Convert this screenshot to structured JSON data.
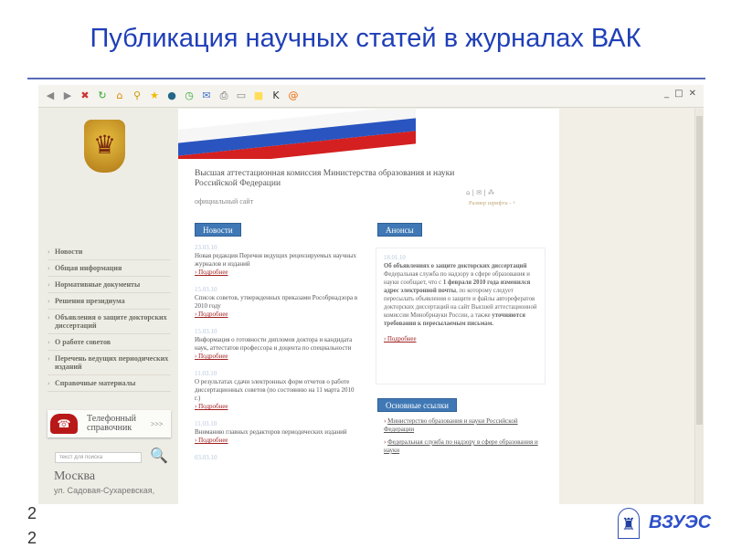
{
  "slide": {
    "title": "Публикация научных статей в журналах ВАК",
    "page_numbers": [
      "2",
      "2"
    ],
    "logo_text": "ВЗУЭС"
  },
  "browser": {
    "toolbar_icons": [
      "back-icon",
      "forward-icon",
      "stop-icon",
      "refresh-icon",
      "home-icon",
      "search-icon",
      "favorites-icon",
      "web-icon",
      "history-icon",
      "mail-icon",
      "print-icon",
      "edit-icon",
      "note-icon",
      "k-icon",
      "email-at-icon"
    ]
  },
  "site": {
    "org_title": "Высшая аттестационная комиссия Министерства образования и науки Российской Федерации",
    "subtitle": "официальный сайт",
    "font_size_label": "Размер шрифта",
    "font_minus": "-",
    "font_plus": "+",
    "nav": [
      "Новости",
      "Общая информация",
      "Нормативные документы",
      "Решения президиума",
      "Объявления о защите докторских диссертаций",
      "О работе советов",
      "Перечень ведущих периодических изданий",
      "Справочные материалы"
    ],
    "phone_banner": {
      "label": "Телефонный справочник",
      "arrow": ">>>"
    },
    "search_placeholder": "текст для поиска",
    "city": "Москва",
    "address": "ул. Садовая-Сухаревская,",
    "news": {
      "header": "Новости",
      "more": "Подробнее",
      "items": [
        {
          "date": "23.03.10",
          "text": "Новая редакция Перечня ведущих рецензируемых научных журналов и изданий"
        },
        {
          "date": "15.03.10",
          "text": "Список советов, утвержденных приказами Рособрнадзора в 2010 году"
        },
        {
          "date": "15.03.10",
          "text": "Информация о готовности дипломов доктора и кандидата наук, аттестатов профессора и доцента по специальности"
        },
        {
          "date": "11.03.10",
          "text": "О результатах сдачи электронных форм отчетов о работе диссертационных советов (по состоянию на 11 марта 2010 г.)"
        },
        {
          "date": "11.03.10",
          "text": "Вниманию главных редакторов периодических изданий"
        },
        {
          "date": "03.03.10",
          "text": ""
        }
      ]
    },
    "announcements": {
      "header": "Анонсы",
      "date": "18.01.10",
      "title": "Об объявлениях о защите докторских диссертаций",
      "text1": "Федеральная служба по надзору в сфере образования и науки сообщает, что с ",
      "bold1": "1 февраля 2010 года изменился адрес электронной почты",
      "text2": ", по которому следует пересылать объявления о защите и файлы авторефератов докторских диссертаций на сайт Высшей аттестационной комиссии Минобрнауки России, а также ",
      "bold2": "уточняются требования к пересылаемым письмам.",
      "more": "Подробнее"
    },
    "links": {
      "header": "Основные ссылки",
      "items": [
        "Министерство образования и науки Российской Федерации",
        "Федеральная служба по надзору в сфере образования и науки"
      ]
    }
  }
}
